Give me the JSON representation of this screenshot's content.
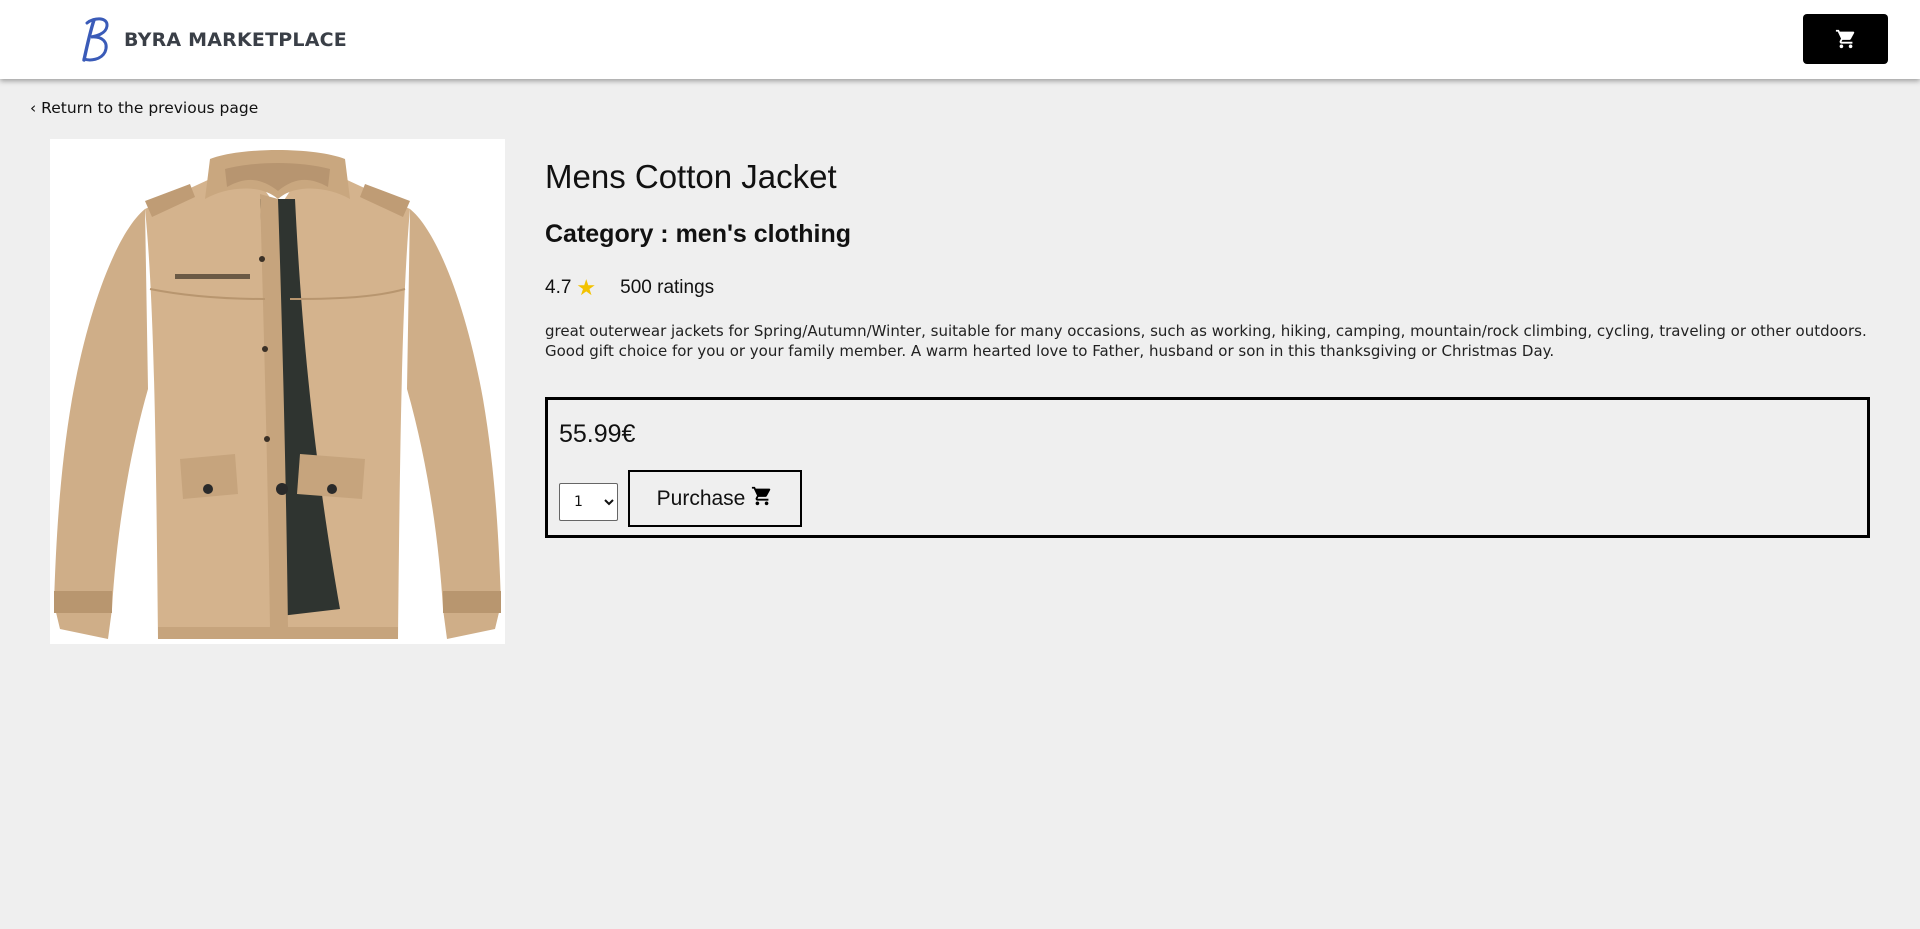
{
  "header": {
    "brand": "BYRA MARKETPLACE",
    "brand_color": "#3a5bb8",
    "cart_icon": "shopping-cart-icon"
  },
  "nav": {
    "back_label": "‹ Return to the previous page"
  },
  "product": {
    "title": "Mens Cotton Jacket",
    "category": "Category : men's clothing",
    "rating": "4.7",
    "star": "★",
    "rating_count": "500 ratings",
    "description": "great outerwear jackets for Spring/Autumn/Winter, suitable for many occasions, such as working, hiking, camping, mountain/rock climbing, cycling, traveling or other outdoors. Good gift choice for you or your family member. A warm hearted love to Father, husband or son in this thanksgiving or Christmas Day.",
    "price": "55.99€",
    "quantity": "1",
    "purchase_label": "Purchase",
    "image_icon": "jacket-image"
  },
  "colors": {
    "background": "#efefef",
    "accent_star": "#f2c200",
    "button_dark": "#000000"
  }
}
